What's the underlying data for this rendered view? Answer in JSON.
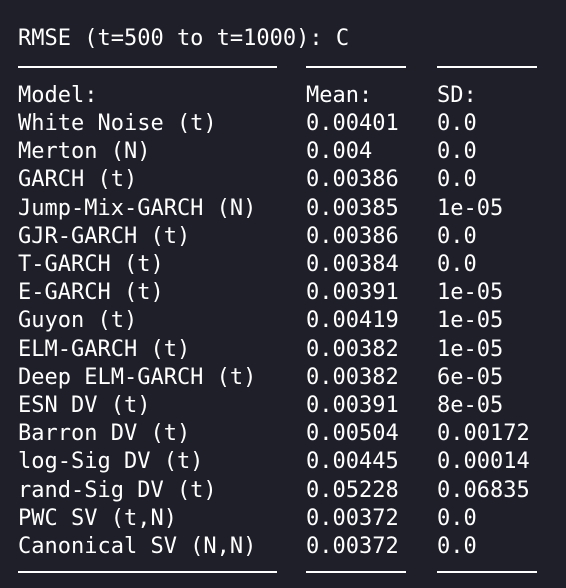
{
  "title": "RMSE (t=500 to t=1000): C",
  "dash_text": "-----------------",
  "headers": {
    "model": "Model:",
    "mean": "Mean:",
    "sd": "SD:"
  },
  "rows": [
    {
      "model": "White Noise (t)",
      "mean": "0.00401",
      "sd": "0.0"
    },
    {
      "model": "Merton (N)",
      "mean": "0.004",
      "sd": "0.0"
    },
    {
      "model": "GARCH (t)",
      "mean": "0.00386",
      "sd": "0.0"
    },
    {
      "model": "Jump-Mix-GARCH (N)",
      "mean": "0.00385",
      "sd": "1e-05"
    },
    {
      "model": "GJR-GARCH (t)",
      "mean": "0.00386",
      "sd": "0.0"
    },
    {
      "model": "T-GARCH (t)",
      "mean": "0.00384",
      "sd": "0.0"
    },
    {
      "model": "E-GARCH (t)",
      "mean": "0.00391",
      "sd": "1e-05"
    },
    {
      "model": "Guyon (t)",
      "mean": "0.00419",
      "sd": "1e-05"
    },
    {
      "model": "ELM-GARCH (t)",
      "mean": "0.00382",
      "sd": "1e-05"
    },
    {
      "model": "Deep ELM-GARCH (t)",
      "mean": "0.00382",
      "sd": "6e-05"
    },
    {
      "model": "ESN DV (t)",
      "mean": "0.00391",
      "sd": "8e-05"
    },
    {
      "model": "Barron DV (t)",
      "mean": "0.00504",
      "sd": "0.00172"
    },
    {
      "model": "log-Sig DV (t)",
      "mean": "0.00445",
      "sd": "0.00014"
    },
    {
      "model": "rand-Sig DV (t)",
      "mean": "0.05228",
      "sd": "0.06835"
    },
    {
      "model": "PWC SV (t,N)",
      "mean": "0.00372",
      "sd": "0.0"
    },
    {
      "model": "Canonical SV (N,N)",
      "mean": "0.00372",
      "sd": "0.0"
    }
  ]
}
